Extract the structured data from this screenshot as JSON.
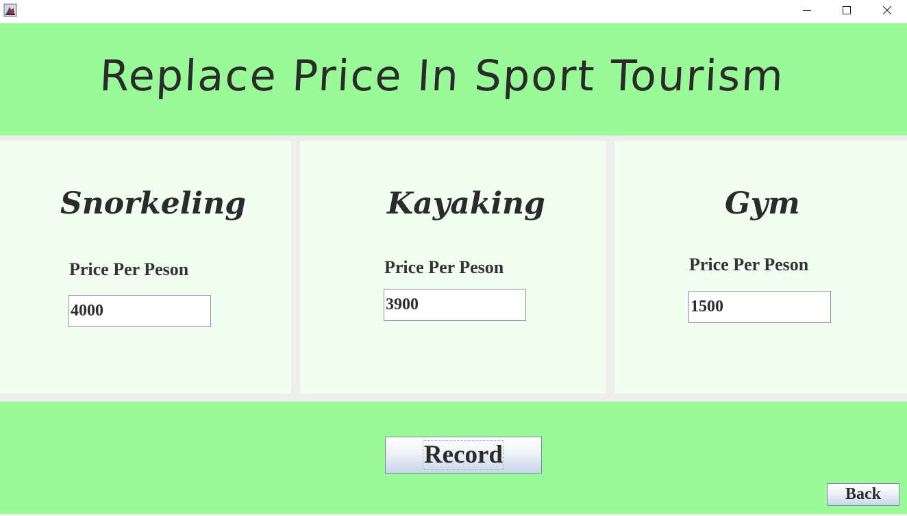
{
  "window": {
    "app_icon": "java-app-icon",
    "controls": {
      "minimize": "minimize-icon",
      "maximize": "maximize-icon",
      "close": "close-icon"
    }
  },
  "header": {
    "title": "Replace Price In Sport Tourism"
  },
  "sports": [
    {
      "name": "Snorkeling",
      "price_label": "Price Per Peson",
      "price_value": "4000"
    },
    {
      "name": "Kayaking",
      "price_label": "Price Per Peson",
      "price_value": "3900"
    },
    {
      "name": "Gym",
      "price_label": "Price Per Peson",
      "price_value": "1500"
    }
  ],
  "footer": {
    "record_label": "Record",
    "back_label": "Back"
  },
  "colors": {
    "header_bg": "#99fb98",
    "panel_bg": "#f0fff0",
    "text": "#2b2b2b"
  }
}
